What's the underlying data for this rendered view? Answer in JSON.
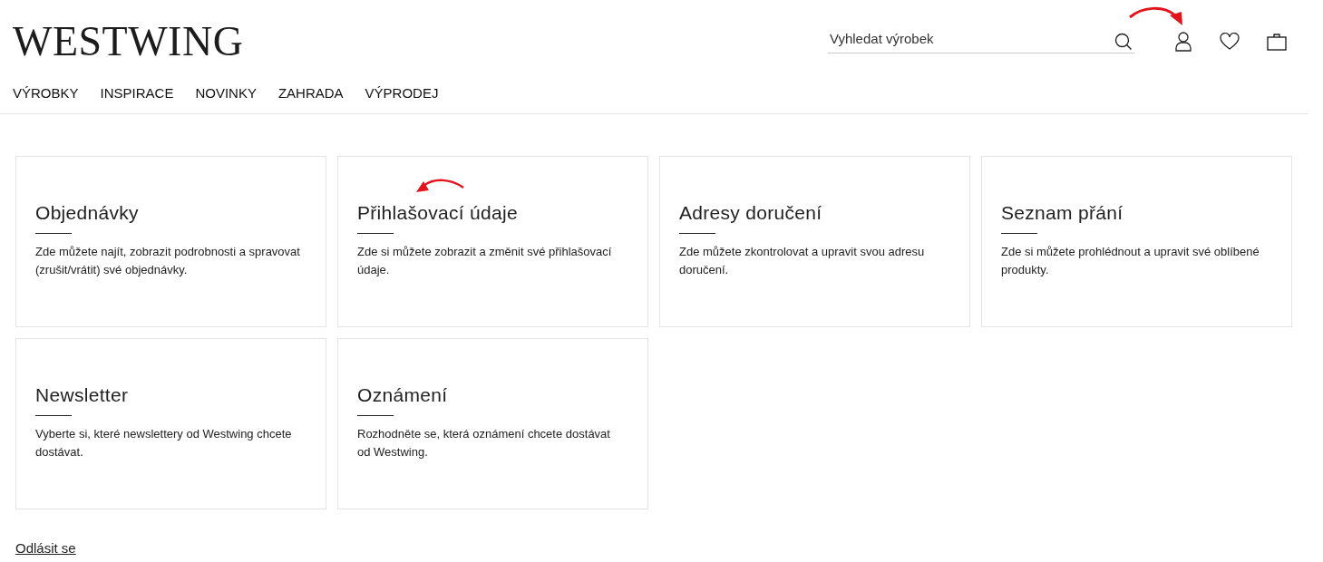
{
  "header": {
    "logo": "WESTWING",
    "nav": [
      {
        "label": "VÝROBKY"
      },
      {
        "label": "INSPIRACE"
      },
      {
        "label": "NOVINKY"
      },
      {
        "label": "ZAHRADA"
      },
      {
        "label": "VÝPRODEJ"
      }
    ],
    "search": {
      "placeholder": "Vyhledat výrobek"
    }
  },
  "cards": [
    {
      "title": "Objednávky",
      "text": "Zde můžete najít, zobrazit podrobnosti a spravovat (zrušit/vrátit) své objednávky."
    },
    {
      "title": "Přihlašovací údaje",
      "text": "Zde si můžete zobrazit a změnit své přihlašovací údaje."
    },
    {
      "title": "Adresy doručení",
      "text": "Zde můžete zkontrolovat a upravit svou adresu doručení."
    },
    {
      "title": "Seznam přání",
      "text": "Zde si můžete prohlédnout a upravit své oblíbené produkty."
    },
    {
      "title": "Newsletter",
      "text": "Vyberte si, které newslettery od Westwing chcete dostávat."
    },
    {
      "title": "Oznámení",
      "text": "Rozhodněte se, která oznámení chcete dostávat od Westwing."
    }
  ],
  "logout": "Odlásit se"
}
